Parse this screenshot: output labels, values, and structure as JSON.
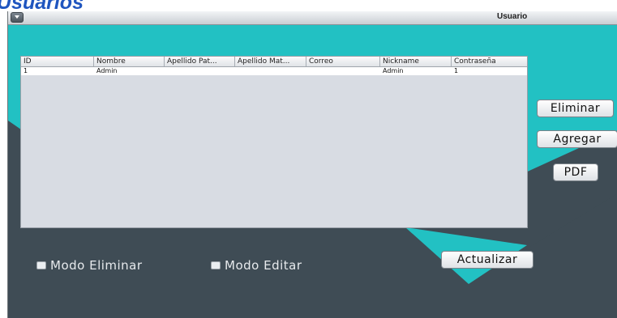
{
  "page_heading": "Usuarios",
  "window": {
    "title": "Usuario"
  },
  "table": {
    "columns": [
      "ID",
      "Nombre",
      "Apellido Pat...",
      "Apellido Mat...",
      "Correo",
      "Nickname",
      "Contraseña"
    ],
    "rows": [
      [
        "1",
        "Admin",
        "",
        "",
        "",
        "Admin",
        "1"
      ]
    ]
  },
  "buttons": {
    "eliminar": "Eliminar",
    "agregar": "Agregar",
    "pdf": "PDF",
    "actualizar": "Actualizar"
  },
  "checkboxes": {
    "modo_eliminar": "Modo Eliminar",
    "modo_editar": "Modo Editar"
  },
  "colors": {
    "teal": "#22c1c3",
    "dark": "#3f4c55"
  }
}
